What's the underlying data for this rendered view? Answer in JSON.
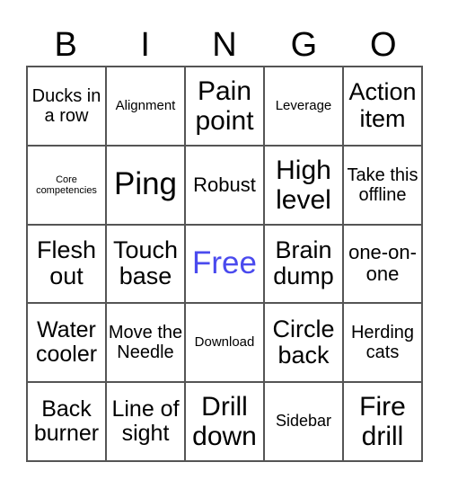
{
  "header": [
    "B",
    "I",
    "N",
    "G",
    "O"
  ],
  "free_color": "#4a4aee",
  "cells": [
    {
      "text": "Ducks in a row",
      "size": "s20"
    },
    {
      "text": "Alignment",
      "size": "s15"
    },
    {
      "text": "Pain point",
      "size": "s30"
    },
    {
      "text": "Leverage",
      "size": "s15"
    },
    {
      "text": "Action item",
      "size": "s27"
    },
    {
      "text": "Core competencies",
      "size": "s11"
    },
    {
      "text": "Ping",
      "size": "s34"
    },
    {
      "text": "Robust",
      "size": "s22"
    },
    {
      "text": "High level",
      "size": "s30"
    },
    {
      "text": "Take this offline",
      "size": "s20"
    },
    {
      "text": "Flesh out",
      "size": "s27"
    },
    {
      "text": "Touch base",
      "size": "s27"
    },
    {
      "text": "Free",
      "size": "s34",
      "free": true
    },
    {
      "text": "Brain dump",
      "size": "s27"
    },
    {
      "text": "one-on-one",
      "size": "s22"
    },
    {
      "text": "Water cooler",
      "size": "s24"
    },
    {
      "text": "Move the Needle",
      "size": "s20"
    },
    {
      "text": "Download",
      "size": "s15"
    },
    {
      "text": "Circle back",
      "size": "s27"
    },
    {
      "text": "Herding cats",
      "size": "s20"
    },
    {
      "text": "Back burner",
      "size": "s24"
    },
    {
      "text": "Line of sight",
      "size": "s24"
    },
    {
      "text": "Drill down",
      "size": "s30"
    },
    {
      "text": "Sidebar",
      "size": "s18"
    },
    {
      "text": "Fire drill",
      "size": "s30"
    }
  ]
}
